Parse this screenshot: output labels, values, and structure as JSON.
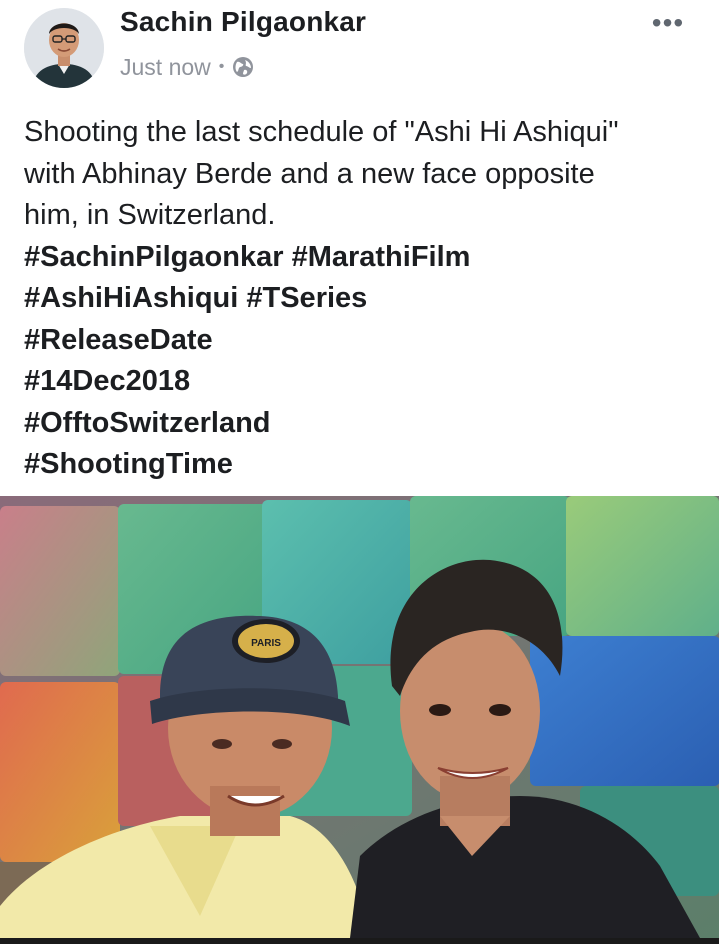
{
  "author": {
    "name": "Sachin Pilgaonkar",
    "timestamp": "Just now",
    "separator": "•",
    "privacy_icon": "globe-icon",
    "avatar_icon": "avatar"
  },
  "menu": {
    "more_label": "•••",
    "more_icon": "more-options-icon"
  },
  "post": {
    "text_lines": [
      "Shooting the last schedule of \"Ashi Hi Ashiqui\"",
      "with Abhinay Berde and a new face opposite",
      "him, in Switzerland."
    ],
    "hashtag_lines": [
      [
        "#SachinPilgaonkar",
        "#MarathiFilm"
      ],
      [
        "#AshiHiAshiqui",
        "#TSeries"
      ],
      [
        "#ReleaseDate"
      ],
      [
        "#14Dec2018"
      ],
      [
        "#OfftoSwitzerland"
      ],
      [
        "#ShootingTime"
      ]
    ]
  },
  "photo": {
    "cap_badge_text": "PARIS",
    "description_icon": "post-photo"
  },
  "colors": {
    "name_text": "#1c1e21",
    "meta_text": "#90949c",
    "background": "#ffffff"
  }
}
